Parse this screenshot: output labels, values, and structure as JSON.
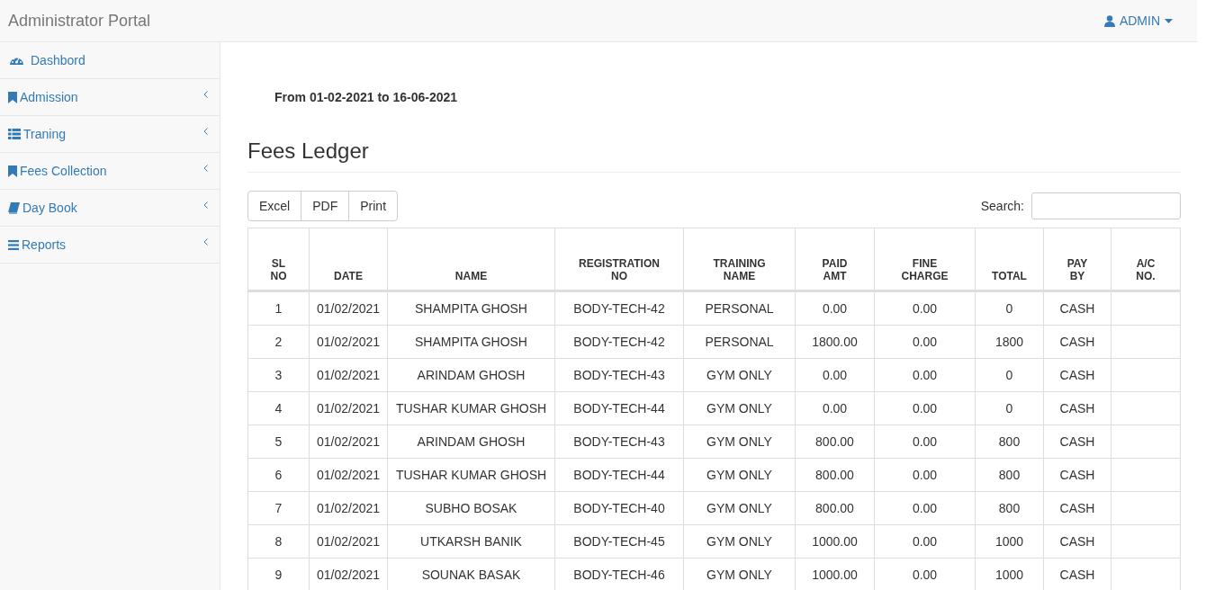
{
  "brand": "Administrator Portal",
  "user_menu": {
    "label": "ADMIN"
  },
  "sidebar": {
    "items": [
      {
        "label": "Dashbord",
        "kind": "dashboard",
        "has_submenu": false
      },
      {
        "label": "Admission",
        "kind": "bookmark",
        "has_submenu": true
      },
      {
        "label": "Traning",
        "kind": "list",
        "has_submenu": true
      },
      {
        "label": "Fees Collection",
        "kind": "bookmark",
        "has_submenu": true
      },
      {
        "label": "Day Book",
        "kind": "book",
        "has_submenu": true
      },
      {
        "label": "Reports",
        "kind": "bars",
        "has_submenu": true
      }
    ]
  },
  "date_range": "From 01-02-2021 to 16-06-2021",
  "heading": "Fees Ledger",
  "export_buttons": [
    "Excel",
    "PDF",
    "Print"
  ],
  "search": {
    "label": "Search:"
  },
  "table": {
    "columns": [
      "SL\nNO",
      "DATE",
      "NAME",
      "REGISTRATION\nNO",
      "TRAINING\nNAME",
      "PAID\nAMT",
      "FINE\nCHARGE",
      "TOTAL",
      "PAY\nBY",
      "A/C\nNO."
    ],
    "rows": [
      [
        "1",
        "01/02/2021",
        "SHAMPITA GHOSH",
        "BODY-TECH-42",
        "PERSONAL",
        "0.00",
        "0.00",
        "0",
        "CASH",
        ""
      ],
      [
        "2",
        "01/02/2021",
        "SHAMPITA GHOSH",
        "BODY-TECH-42",
        "PERSONAL",
        "1800.00",
        "0.00",
        "1800",
        "CASH",
        ""
      ],
      [
        "3",
        "01/02/2021",
        "ARINDAM GHOSH",
        "BODY-TECH-43",
        "GYM ONLY",
        "0.00",
        "0.00",
        "0",
        "CASH",
        ""
      ],
      [
        "4",
        "01/02/2021",
        "TUSHAR KUMAR GHOSH",
        "BODY-TECH-44",
        "GYM ONLY",
        "0.00",
        "0.00",
        "0",
        "CASH",
        ""
      ],
      [
        "5",
        "01/02/2021",
        "ARINDAM GHOSH",
        "BODY-TECH-43",
        "GYM ONLY",
        "800.00",
        "0.00",
        "800",
        "CASH",
        ""
      ],
      [
        "6",
        "01/02/2021",
        "TUSHAR KUMAR GHOSH",
        "BODY-TECH-44",
        "GYM ONLY",
        "800.00",
        "0.00",
        "800",
        "CASH",
        ""
      ],
      [
        "7",
        "01/02/2021",
        "SUBHO BOSAK",
        "BODY-TECH-40",
        "GYM ONLY",
        "800.00",
        "0.00",
        "800",
        "CASH",
        ""
      ],
      [
        "8",
        "01/02/2021",
        "UTKARSH BANIK",
        "BODY-TECH-45",
        "GYM ONLY",
        "1000.00",
        "0.00",
        "1000",
        "CASH",
        ""
      ],
      [
        "9",
        "01/02/2021",
        "SOUNAK BASAK",
        "BODY-TECH-46",
        "GYM ONLY",
        "1000.00",
        "0.00",
        "1000",
        "CASH",
        ""
      ]
    ]
  }
}
